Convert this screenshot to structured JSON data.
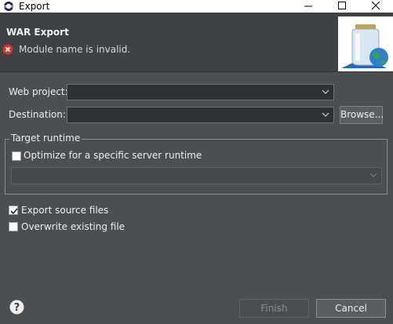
{
  "window": {
    "title": "Export",
    "minimize_icon": "minimize-icon",
    "maximize_icon": "maximize-icon",
    "close_icon": "close-icon"
  },
  "header": {
    "title": "WAR Export",
    "error_message": "Module name is invalid.",
    "error_icon": "error-icon",
    "wizard_image": "jar-globe-icon"
  },
  "form": {
    "web_project": {
      "label": "Web project:",
      "value": ""
    },
    "destination": {
      "label": "Destination:",
      "value": ""
    },
    "browse_button": "Browse..."
  },
  "target_runtime": {
    "group_label": "Target runtime",
    "optimize_label": "Optimize for a specific server runtime",
    "optimize_checked": false,
    "runtime_value": ""
  },
  "options": {
    "export_source": {
      "label": "Export source files",
      "checked": true
    },
    "overwrite": {
      "label": "Overwrite existing file",
      "checked": false
    }
  },
  "footer": {
    "help_icon": "help-icon",
    "finish_button": "Finish",
    "cancel_button": "Cancel"
  }
}
